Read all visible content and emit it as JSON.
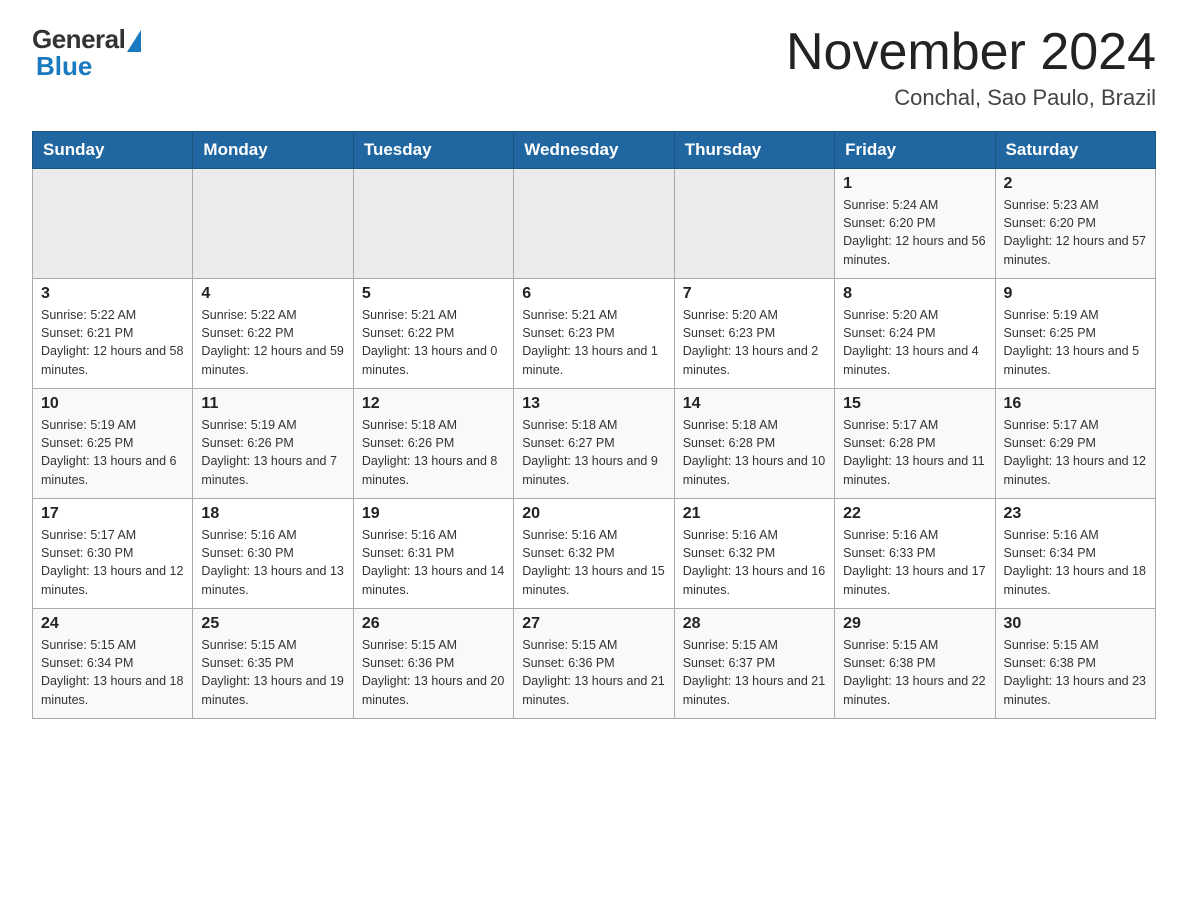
{
  "header": {
    "logo_general": "General",
    "logo_blue": "Blue",
    "month_title": "November 2024",
    "location": "Conchal, Sao Paulo, Brazil"
  },
  "weekdays": [
    "Sunday",
    "Monday",
    "Tuesday",
    "Wednesday",
    "Thursday",
    "Friday",
    "Saturday"
  ],
  "weeks": [
    [
      {
        "day": "",
        "info": ""
      },
      {
        "day": "",
        "info": ""
      },
      {
        "day": "",
        "info": ""
      },
      {
        "day": "",
        "info": ""
      },
      {
        "day": "",
        "info": ""
      },
      {
        "day": "1",
        "info": "Sunrise: 5:24 AM\nSunset: 6:20 PM\nDaylight: 12 hours and 56 minutes."
      },
      {
        "day": "2",
        "info": "Sunrise: 5:23 AM\nSunset: 6:20 PM\nDaylight: 12 hours and 57 minutes."
      }
    ],
    [
      {
        "day": "3",
        "info": "Sunrise: 5:22 AM\nSunset: 6:21 PM\nDaylight: 12 hours and 58 minutes."
      },
      {
        "day": "4",
        "info": "Sunrise: 5:22 AM\nSunset: 6:22 PM\nDaylight: 12 hours and 59 minutes."
      },
      {
        "day": "5",
        "info": "Sunrise: 5:21 AM\nSunset: 6:22 PM\nDaylight: 13 hours and 0 minutes."
      },
      {
        "day": "6",
        "info": "Sunrise: 5:21 AM\nSunset: 6:23 PM\nDaylight: 13 hours and 1 minute."
      },
      {
        "day": "7",
        "info": "Sunrise: 5:20 AM\nSunset: 6:23 PM\nDaylight: 13 hours and 2 minutes."
      },
      {
        "day": "8",
        "info": "Sunrise: 5:20 AM\nSunset: 6:24 PM\nDaylight: 13 hours and 4 minutes."
      },
      {
        "day": "9",
        "info": "Sunrise: 5:19 AM\nSunset: 6:25 PM\nDaylight: 13 hours and 5 minutes."
      }
    ],
    [
      {
        "day": "10",
        "info": "Sunrise: 5:19 AM\nSunset: 6:25 PM\nDaylight: 13 hours and 6 minutes."
      },
      {
        "day": "11",
        "info": "Sunrise: 5:19 AM\nSunset: 6:26 PM\nDaylight: 13 hours and 7 minutes."
      },
      {
        "day": "12",
        "info": "Sunrise: 5:18 AM\nSunset: 6:26 PM\nDaylight: 13 hours and 8 minutes."
      },
      {
        "day": "13",
        "info": "Sunrise: 5:18 AM\nSunset: 6:27 PM\nDaylight: 13 hours and 9 minutes."
      },
      {
        "day": "14",
        "info": "Sunrise: 5:18 AM\nSunset: 6:28 PM\nDaylight: 13 hours and 10 minutes."
      },
      {
        "day": "15",
        "info": "Sunrise: 5:17 AM\nSunset: 6:28 PM\nDaylight: 13 hours and 11 minutes."
      },
      {
        "day": "16",
        "info": "Sunrise: 5:17 AM\nSunset: 6:29 PM\nDaylight: 13 hours and 12 minutes."
      }
    ],
    [
      {
        "day": "17",
        "info": "Sunrise: 5:17 AM\nSunset: 6:30 PM\nDaylight: 13 hours and 12 minutes."
      },
      {
        "day": "18",
        "info": "Sunrise: 5:16 AM\nSunset: 6:30 PM\nDaylight: 13 hours and 13 minutes."
      },
      {
        "day": "19",
        "info": "Sunrise: 5:16 AM\nSunset: 6:31 PM\nDaylight: 13 hours and 14 minutes."
      },
      {
        "day": "20",
        "info": "Sunrise: 5:16 AM\nSunset: 6:32 PM\nDaylight: 13 hours and 15 minutes."
      },
      {
        "day": "21",
        "info": "Sunrise: 5:16 AM\nSunset: 6:32 PM\nDaylight: 13 hours and 16 minutes."
      },
      {
        "day": "22",
        "info": "Sunrise: 5:16 AM\nSunset: 6:33 PM\nDaylight: 13 hours and 17 minutes."
      },
      {
        "day": "23",
        "info": "Sunrise: 5:16 AM\nSunset: 6:34 PM\nDaylight: 13 hours and 18 minutes."
      }
    ],
    [
      {
        "day": "24",
        "info": "Sunrise: 5:15 AM\nSunset: 6:34 PM\nDaylight: 13 hours and 18 minutes."
      },
      {
        "day": "25",
        "info": "Sunrise: 5:15 AM\nSunset: 6:35 PM\nDaylight: 13 hours and 19 minutes."
      },
      {
        "day": "26",
        "info": "Sunrise: 5:15 AM\nSunset: 6:36 PM\nDaylight: 13 hours and 20 minutes."
      },
      {
        "day": "27",
        "info": "Sunrise: 5:15 AM\nSunset: 6:36 PM\nDaylight: 13 hours and 21 minutes."
      },
      {
        "day": "28",
        "info": "Sunrise: 5:15 AM\nSunset: 6:37 PM\nDaylight: 13 hours and 21 minutes."
      },
      {
        "day": "29",
        "info": "Sunrise: 5:15 AM\nSunset: 6:38 PM\nDaylight: 13 hours and 22 minutes."
      },
      {
        "day": "30",
        "info": "Sunrise: 5:15 AM\nSunset: 6:38 PM\nDaylight: 13 hours and 23 minutes."
      }
    ]
  ]
}
